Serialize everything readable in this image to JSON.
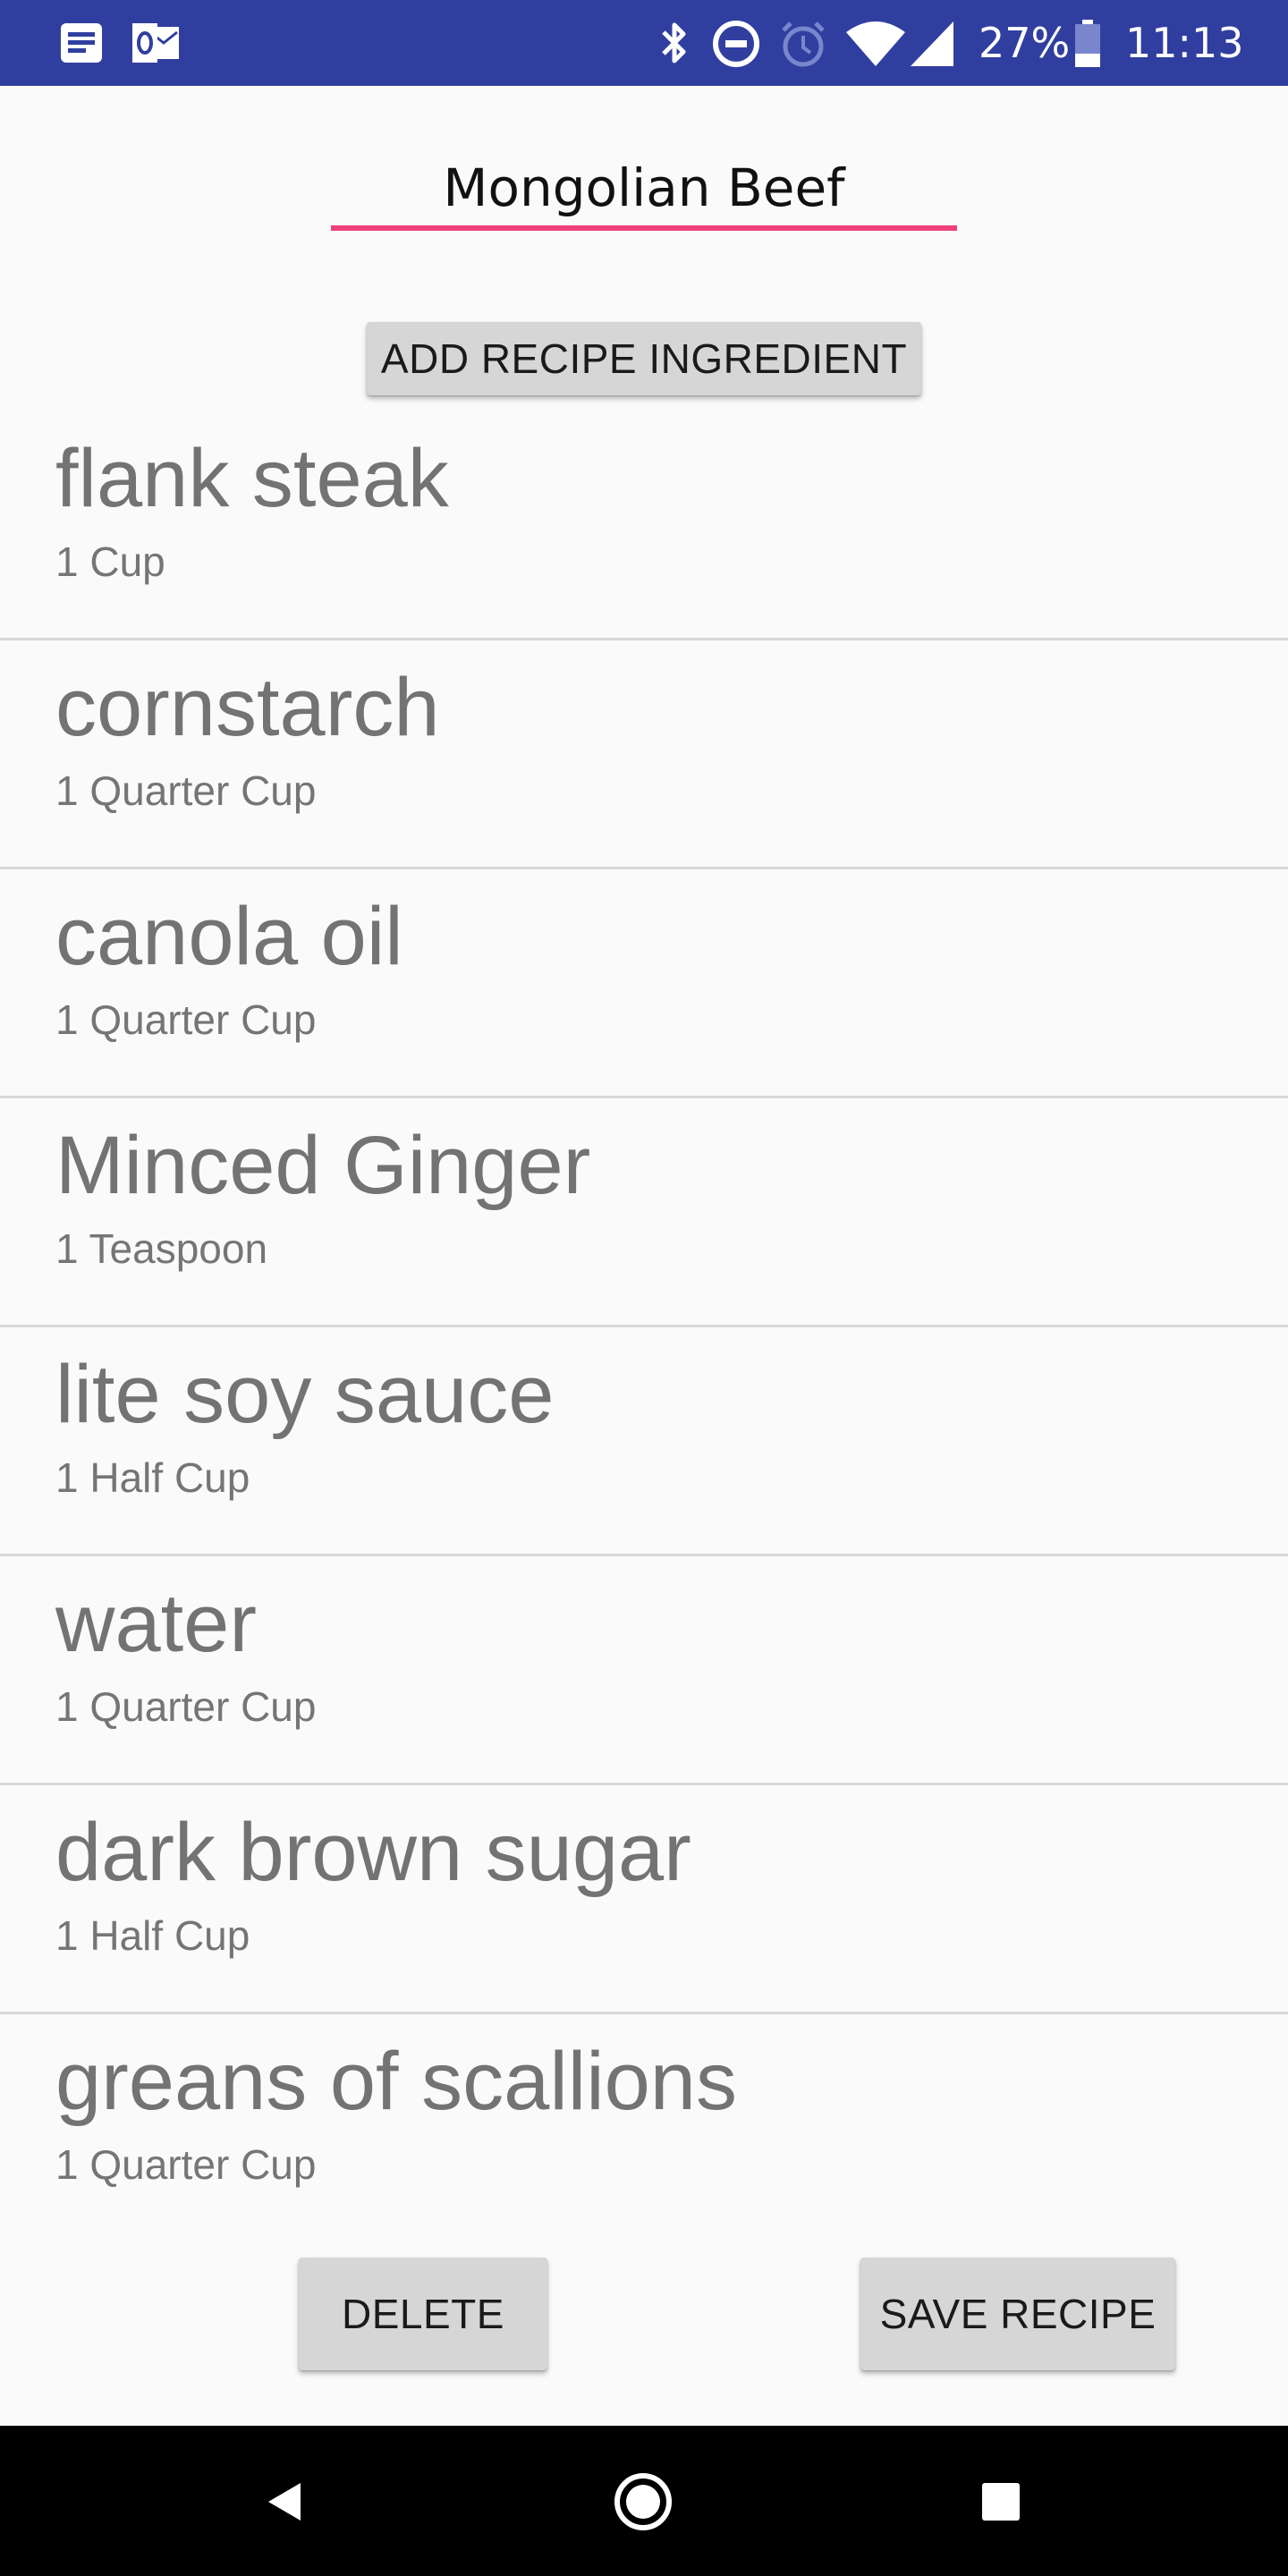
{
  "status_bar": {
    "battery_percent": "27%",
    "time": "11:13",
    "icons": [
      "news-icon",
      "outlook-icon",
      "bluetooth-icon",
      "do-not-disturb-icon",
      "alarm-icon",
      "wifi-icon",
      "signal-icon",
      "battery-icon"
    ],
    "background": "#303f9f"
  },
  "recipe": {
    "name": "Mongolian Beef",
    "underline_color": "#ec407a"
  },
  "add_ingredient_button": {
    "label": "ADD RECIPE INGREDIENT"
  },
  "ingredients": [
    {
      "name": "flank steak",
      "quantity": "1 Cup"
    },
    {
      "name": "cornstarch",
      "quantity": "1 Quarter Cup"
    },
    {
      "name": "canola oil",
      "quantity": "1 Quarter Cup"
    },
    {
      "name": "Minced Ginger",
      "quantity": "1 Teaspoon"
    },
    {
      "name": "lite soy sauce",
      "quantity": "1 Half Cup"
    },
    {
      "name": "water",
      "quantity": "1 Quarter Cup"
    },
    {
      "name": "dark brown sugar",
      "quantity": "1 Half Cup"
    },
    {
      "name": "greans of scallions",
      "quantity": "1 Quarter Cup"
    }
  ],
  "footer_buttons": {
    "delete_label": "DELETE",
    "save_label": "SAVE RECIPE"
  },
  "nav_bar": {
    "icons": [
      "back-icon",
      "home-icon",
      "recents-icon"
    ]
  }
}
